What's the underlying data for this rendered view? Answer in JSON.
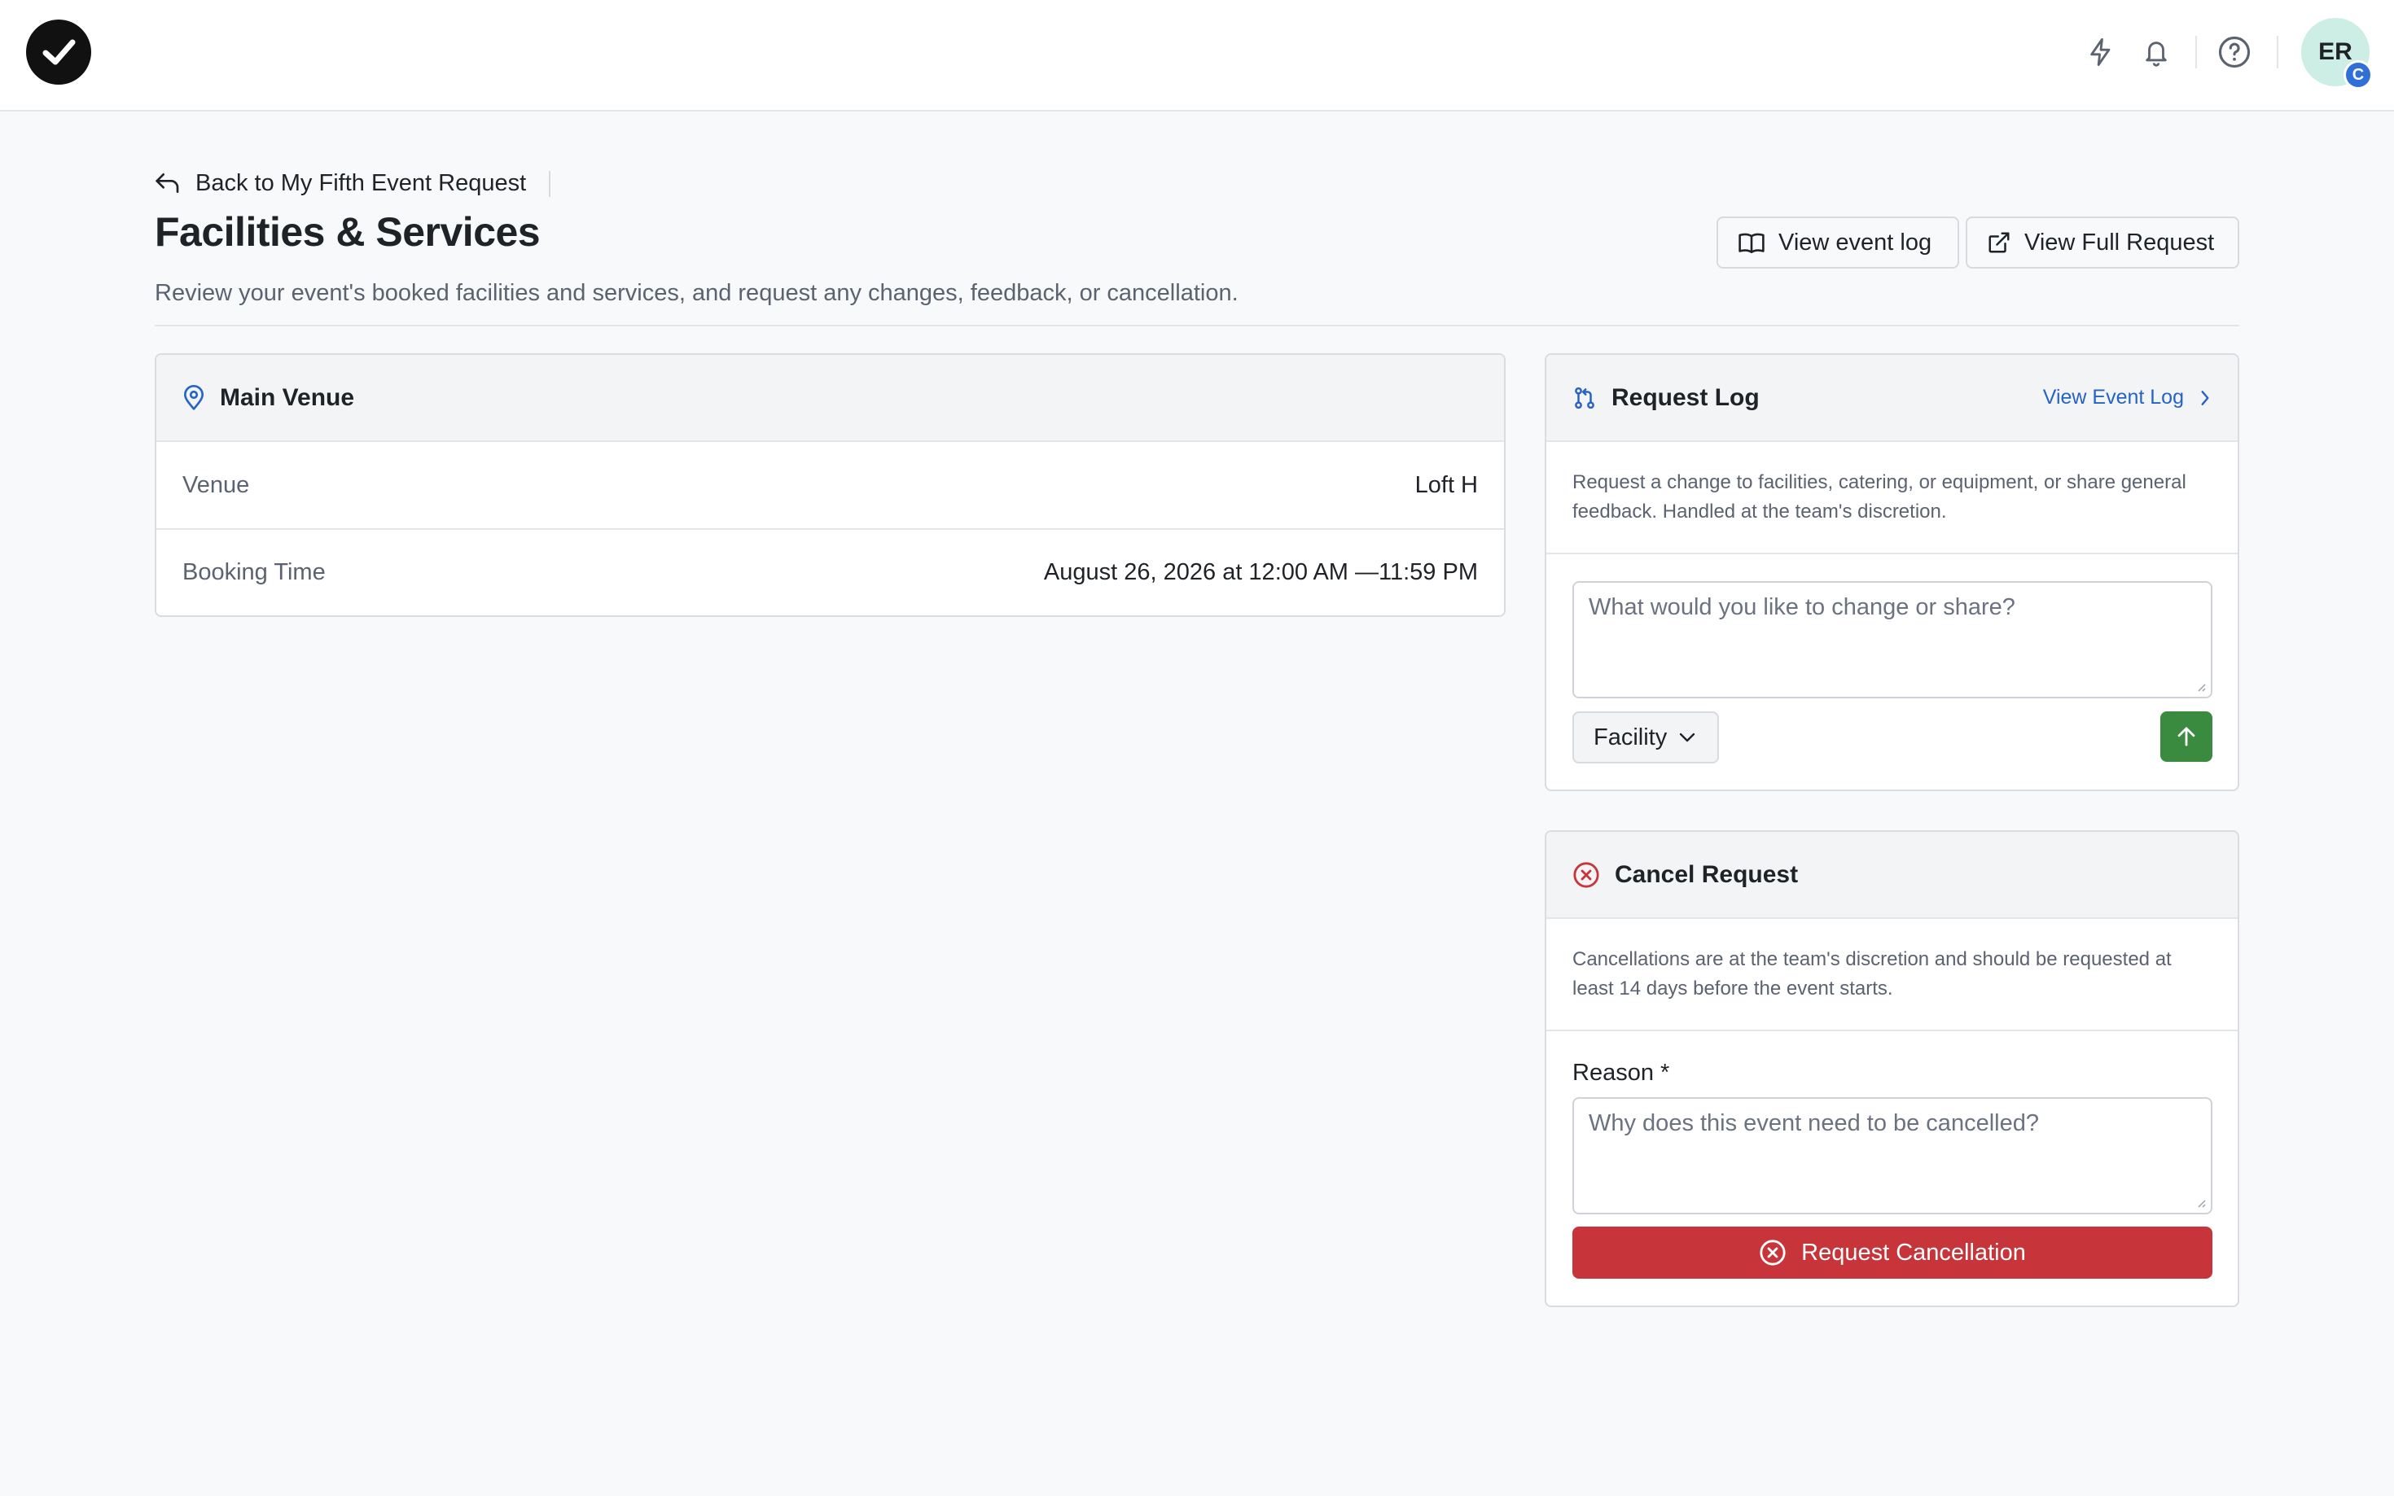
{
  "topbar": {
    "logo_icon": "check-circle-logo-icon",
    "icons": [
      "lightning-icon",
      "bell-icon",
      "help-icon"
    ],
    "avatar_initials": "ER",
    "avatar_badge": "C"
  },
  "header": {
    "back_label": "Back to My Fifth Event Request",
    "title": "Facilities & Services",
    "subtitle": "Review your event's booked facilities and services, and request any changes, feedback, or cancellation.",
    "view_event_log_label": "View event log",
    "view_full_request_label": "View Full Request"
  },
  "venue_card": {
    "title": "Main Venue",
    "rows": [
      {
        "label": "Venue",
        "value": "Loft H"
      },
      {
        "label": "Booking Time",
        "value": "August 26, 2026 at 12:00 AM —11:59 PM"
      }
    ]
  },
  "request_log": {
    "title": "Request Log",
    "link_label": "View Event Log",
    "description": "Request a change to facilities, catering, or equipment, or share general feedback. Handled at the team's discretion.",
    "input_placeholder": "What would you like to change or share?",
    "category_selected": "Facility"
  },
  "cancel_request": {
    "title": "Cancel Request",
    "description": "Cancellations are at the team's discretion and should be requested at least 14 days before the event starts.",
    "reason_label": "Reason *",
    "reason_placeholder": "Why does this event need to be cancelled?",
    "submit_label": "Request Cancellation"
  },
  "colors": {
    "accent_link": "#2663c4",
    "send_button": "#3a8a3f",
    "danger": "#c7353a",
    "avatar_bg": "#cdeee4"
  }
}
